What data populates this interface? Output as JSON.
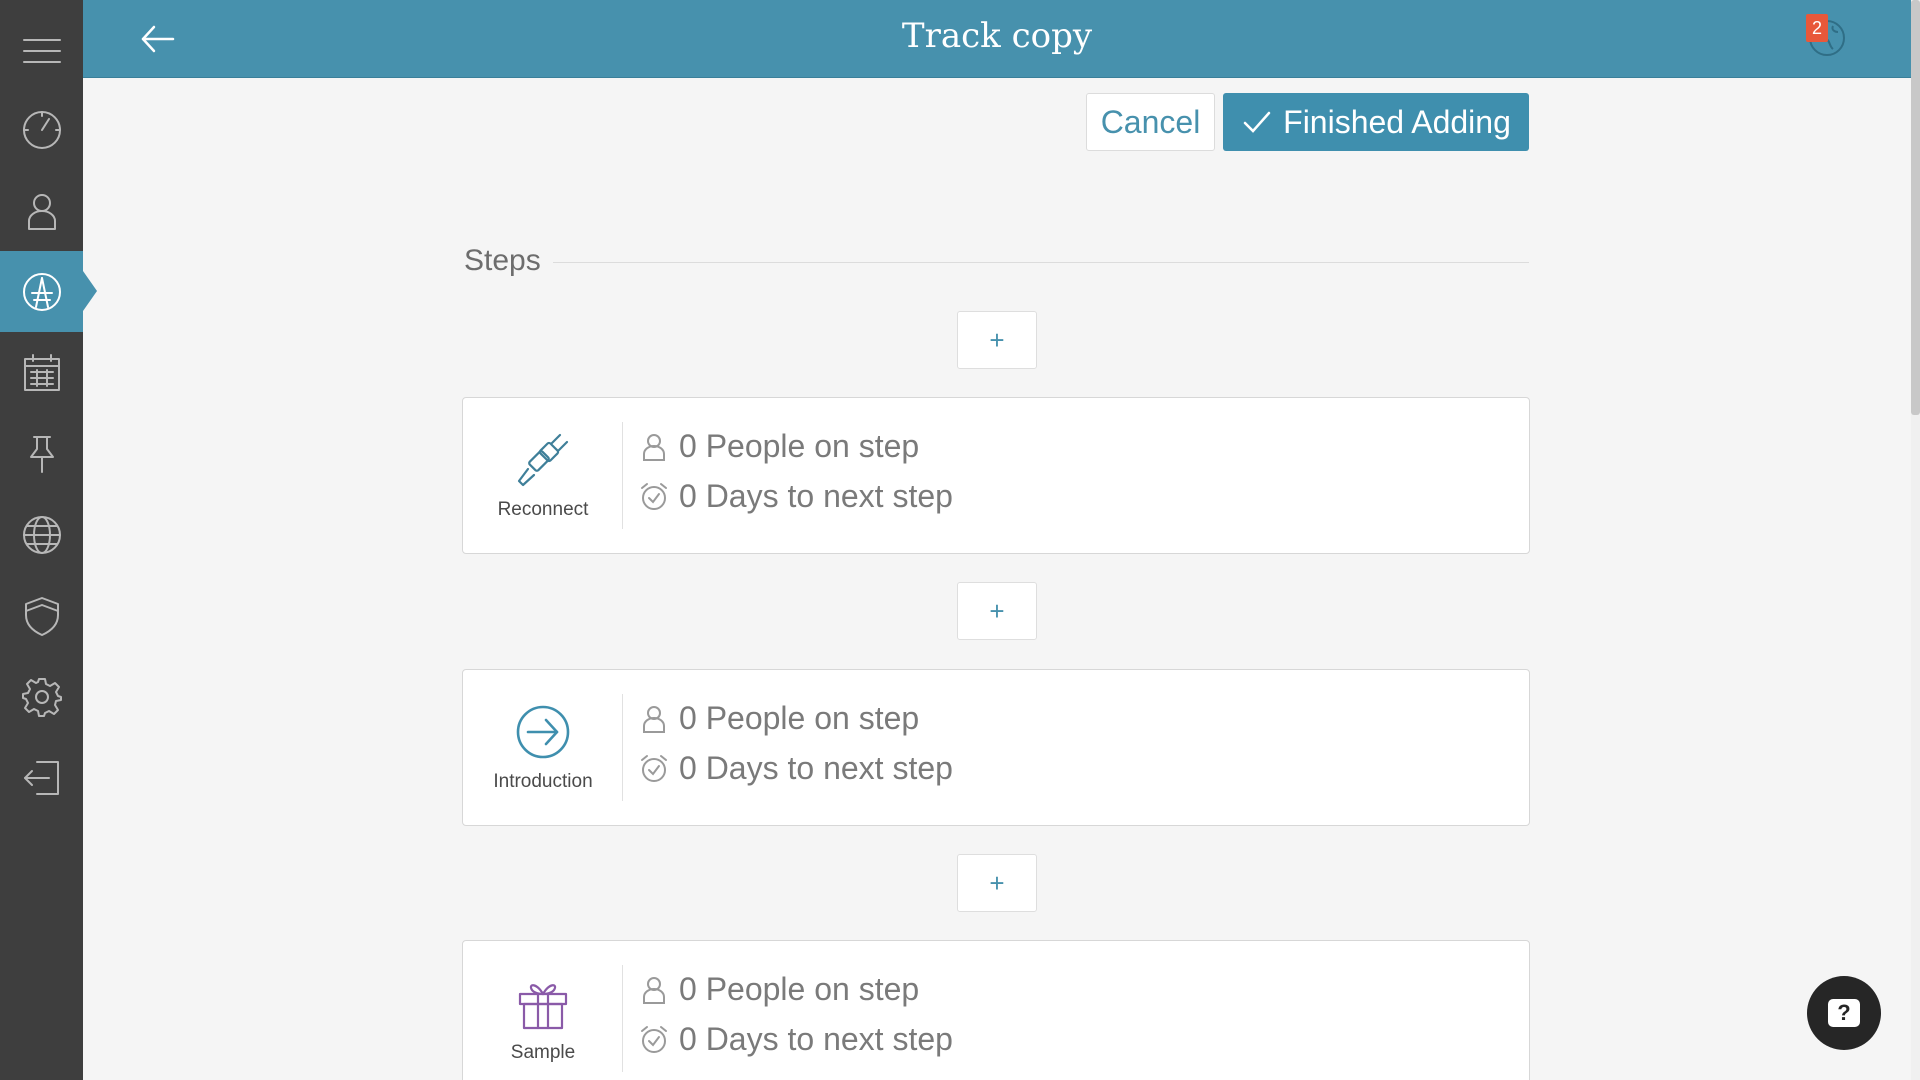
{
  "header": {
    "title": "Track copy",
    "notification_count": "2"
  },
  "sidebar": {
    "items": [
      {
        "icon": "menu-icon"
      },
      {
        "icon": "dashboard-gauge-icon"
      },
      {
        "icon": "person-icon"
      },
      {
        "icon": "tracks-icon",
        "active": true
      },
      {
        "icon": "calendar-icon"
      },
      {
        "icon": "pin-icon"
      },
      {
        "icon": "globe-icon"
      },
      {
        "icon": "shield-icon"
      },
      {
        "icon": "gear-icon"
      },
      {
        "icon": "logout-icon"
      }
    ]
  },
  "actions": {
    "cancel_label": "Cancel",
    "finish_label": "Finished Adding"
  },
  "steps_section": {
    "heading": "Steps",
    "add_label": "+",
    "steps": [
      {
        "name": "Reconnect",
        "icon": "plug-icon",
        "icon_color": "#3f7f99",
        "people": "0 People on step",
        "days": "0 Days to next step"
      },
      {
        "name": "Introduction",
        "icon": "arrow-circle-icon",
        "icon_color": "#3f8fae",
        "people": "0 People on step",
        "days": "0 Days to next step"
      },
      {
        "name": "Sample",
        "icon": "gift-icon",
        "icon_color": "#8a5aa8",
        "people": "0 People on step",
        "days": "0 Days to next step"
      }
    ]
  },
  "help": {
    "label": "?"
  },
  "colors": {
    "accent": "#4791ad",
    "sidebar": "#3e3e3e",
    "badge": "#e8583a"
  }
}
